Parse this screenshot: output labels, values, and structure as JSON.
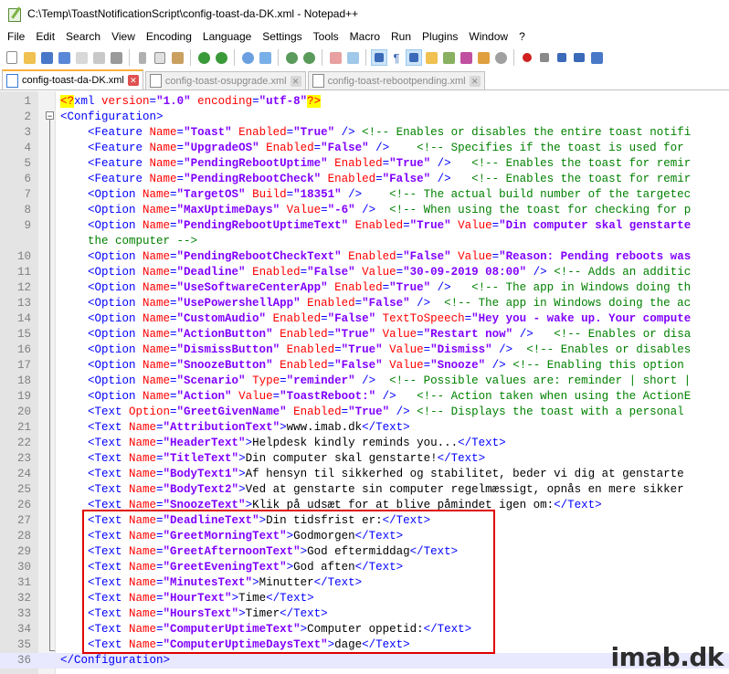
{
  "window": {
    "title": "C:\\Temp\\ToastNotificationScript\\config-toast-da-DK.xml - Notepad++"
  },
  "menu": [
    "File",
    "Edit",
    "Search",
    "View",
    "Encoding",
    "Language",
    "Settings",
    "Tools",
    "Macro",
    "Run",
    "Plugins",
    "Window",
    "?"
  ],
  "tabs": [
    {
      "label": "config-toast-da-DK.xml",
      "active": true
    },
    {
      "label": "config-toast-osupgrade.xml",
      "active": false
    },
    {
      "label": "config-toast-rebootpending.xml",
      "active": false
    }
  ],
  "watermark": "imab.dk",
  "lines": [
    [
      [
        "xmlpi",
        "<?"
      ],
      [
        "b",
        "xml "
      ],
      [
        "r",
        "version"
      ],
      [
        "b",
        "="
      ],
      [
        "p",
        "\"1.0\" "
      ],
      [
        "r",
        "encoding"
      ],
      [
        "b",
        "="
      ],
      [
        "p",
        "\"utf-8\""
      ],
      [
        "xmlpi",
        "?>"
      ]
    ],
    [
      [
        "b",
        "<Configuration>"
      ]
    ],
    [
      [
        "b",
        "    <Feature "
      ],
      [
        "r",
        "Name"
      ],
      [
        "b",
        "="
      ],
      [
        "p",
        "\"Toast\" "
      ],
      [
        "r",
        "Enabled"
      ],
      [
        "b",
        "="
      ],
      [
        "p",
        "\"True\" "
      ],
      [
        "b",
        "/> "
      ],
      [
        "c",
        "<!-- Enables or disables the entire toast notifi"
      ]
    ],
    [
      [
        "b",
        "    <Feature "
      ],
      [
        "r",
        "Name"
      ],
      [
        "b",
        "="
      ],
      [
        "p",
        "\"UpgradeOS\" "
      ],
      [
        "r",
        "Enabled"
      ],
      [
        "b",
        "="
      ],
      [
        "p",
        "\"False\" "
      ],
      [
        "b",
        "/>    "
      ],
      [
        "c",
        "<!-- Specifies if the toast is used for"
      ]
    ],
    [
      [
        "b",
        "    <Feature "
      ],
      [
        "r",
        "Name"
      ],
      [
        "b",
        "="
      ],
      [
        "p",
        "\"PendingRebootUptime\" "
      ],
      [
        "r",
        "Enabled"
      ],
      [
        "b",
        "="
      ],
      [
        "p",
        "\"True\" "
      ],
      [
        "b",
        "/>   "
      ],
      [
        "c",
        "<!-- Enables the toast for remir"
      ]
    ],
    [
      [
        "b",
        "    <Feature "
      ],
      [
        "r",
        "Name"
      ],
      [
        "b",
        "="
      ],
      [
        "p",
        "\"PendingRebootCheck\" "
      ],
      [
        "r",
        "Enabled"
      ],
      [
        "b",
        "="
      ],
      [
        "p",
        "\"False\" "
      ],
      [
        "b",
        "/>   "
      ],
      [
        "c",
        "<!-- Enables the toast for remir"
      ]
    ],
    [
      [
        "b",
        "    <Option "
      ],
      [
        "r",
        "Name"
      ],
      [
        "b",
        "="
      ],
      [
        "p",
        "\"TargetOS\" "
      ],
      [
        "r",
        "Build"
      ],
      [
        "b",
        "="
      ],
      [
        "p",
        "\"18351\" "
      ],
      [
        "b",
        "/>    "
      ],
      [
        "c",
        "<!-- The actual build number of the targetec"
      ]
    ],
    [
      [
        "b",
        "    <Option "
      ],
      [
        "r",
        "Name"
      ],
      [
        "b",
        "="
      ],
      [
        "p",
        "\"MaxUptimeDays\" "
      ],
      [
        "r",
        "Value"
      ],
      [
        "b",
        "="
      ],
      [
        "p",
        "\"-6\" "
      ],
      [
        "b",
        "/>  "
      ],
      [
        "c",
        "<!-- When using the toast for checking for p"
      ]
    ],
    [
      [
        "b",
        "    <Option "
      ],
      [
        "r",
        "Name"
      ],
      [
        "b",
        "="
      ],
      [
        "p",
        "\"PendingRebootUptimeText\" "
      ],
      [
        "r",
        "Enabled"
      ],
      [
        "b",
        "="
      ],
      [
        "p",
        "\"True\" "
      ],
      [
        "r",
        "Value"
      ],
      [
        "b",
        "="
      ],
      [
        "p",
        "\"Din computer skal genstarte"
      ]
    ],
    [
      [
        "c",
        "    the computer -->"
      ]
    ],
    [
      [
        "b",
        "    <Option "
      ],
      [
        "r",
        "Name"
      ],
      [
        "b",
        "="
      ],
      [
        "p",
        "\"PendingRebootCheckText\" "
      ],
      [
        "r",
        "Enabled"
      ],
      [
        "b",
        "="
      ],
      [
        "p",
        "\"False\" "
      ],
      [
        "r",
        "Value"
      ],
      [
        "b",
        "="
      ],
      [
        "p",
        "\"Reason: Pending reboots was"
      ]
    ],
    [
      [
        "b",
        "    <Option "
      ],
      [
        "r",
        "Name"
      ],
      [
        "b",
        "="
      ],
      [
        "p",
        "\"Deadline\" "
      ],
      [
        "r",
        "Enabled"
      ],
      [
        "b",
        "="
      ],
      [
        "p",
        "\"False\" "
      ],
      [
        "r",
        "Value"
      ],
      [
        "b",
        "="
      ],
      [
        "p",
        "\"30-09-2019 08:00\" "
      ],
      [
        "b",
        "/> "
      ],
      [
        "c",
        "<!-- Adds an additic"
      ]
    ],
    [
      [
        "b",
        "    <Option "
      ],
      [
        "r",
        "Name"
      ],
      [
        "b",
        "="
      ],
      [
        "p",
        "\"UseSoftwareCenterApp\" "
      ],
      [
        "r",
        "Enabled"
      ],
      [
        "b",
        "="
      ],
      [
        "p",
        "\"True\" "
      ],
      [
        "b",
        "/>   "
      ],
      [
        "c",
        "<!-- The app in Windows doing th"
      ]
    ],
    [
      [
        "b",
        "    <Option "
      ],
      [
        "r",
        "Name"
      ],
      [
        "b",
        "="
      ],
      [
        "p",
        "\"UsePowershellApp\" "
      ],
      [
        "r",
        "Enabled"
      ],
      [
        "b",
        "="
      ],
      [
        "p",
        "\"False\" "
      ],
      [
        "b",
        "/>  "
      ],
      [
        "c",
        "<!-- The app in Windows doing the ac"
      ]
    ],
    [
      [
        "b",
        "    <Option "
      ],
      [
        "r",
        "Name"
      ],
      [
        "b",
        "="
      ],
      [
        "p",
        "\"CustomAudio\" "
      ],
      [
        "r",
        "Enabled"
      ],
      [
        "b",
        "="
      ],
      [
        "p",
        "\"False\" "
      ],
      [
        "r",
        "TextToSpeech"
      ],
      [
        "b",
        "="
      ],
      [
        "p",
        "\"Hey you - wake up. Your compute"
      ]
    ],
    [
      [
        "b",
        "    <Option "
      ],
      [
        "r",
        "Name"
      ],
      [
        "b",
        "="
      ],
      [
        "p",
        "\"ActionButton\" "
      ],
      [
        "r",
        "Enabled"
      ],
      [
        "b",
        "="
      ],
      [
        "p",
        "\"True\" "
      ],
      [
        "r",
        "Value"
      ],
      [
        "b",
        "="
      ],
      [
        "p",
        "\"Restart now\" "
      ],
      [
        "b",
        "/>   "
      ],
      [
        "c",
        "<!-- Enables or disa"
      ]
    ],
    [
      [
        "b",
        "    <Option "
      ],
      [
        "r",
        "Name"
      ],
      [
        "b",
        "="
      ],
      [
        "p",
        "\"DismissButton\" "
      ],
      [
        "r",
        "Enabled"
      ],
      [
        "b",
        "="
      ],
      [
        "p",
        "\"True\" "
      ],
      [
        "r",
        "Value"
      ],
      [
        "b",
        "="
      ],
      [
        "p",
        "\"Dismiss\" "
      ],
      [
        "b",
        "/>  "
      ],
      [
        "c",
        "<!-- Enables or disables"
      ]
    ],
    [
      [
        "b",
        "    <Option "
      ],
      [
        "r",
        "Name"
      ],
      [
        "b",
        "="
      ],
      [
        "p",
        "\"SnoozeButton\" "
      ],
      [
        "r",
        "Enabled"
      ],
      [
        "b",
        "="
      ],
      [
        "p",
        "\"False\" "
      ],
      [
        "r",
        "Value"
      ],
      [
        "b",
        "="
      ],
      [
        "p",
        "\"Snooze\" "
      ],
      [
        "b",
        "/> "
      ],
      [
        "c",
        "<!-- Enabling this option"
      ]
    ],
    [
      [
        "b",
        "    <Option "
      ],
      [
        "r",
        "Name"
      ],
      [
        "b",
        "="
      ],
      [
        "p",
        "\"Scenario\" "
      ],
      [
        "r",
        "Type"
      ],
      [
        "b",
        "="
      ],
      [
        "p",
        "\"reminder\" "
      ],
      [
        "b",
        "/>  "
      ],
      [
        "c",
        "<!-- Possible values are: reminder | short |"
      ]
    ],
    [
      [
        "b",
        "    <Option "
      ],
      [
        "r",
        "Name"
      ],
      [
        "b",
        "="
      ],
      [
        "p",
        "\"Action\" "
      ],
      [
        "r",
        "Value"
      ],
      [
        "b",
        "="
      ],
      [
        "p",
        "\"ToastReboot:\" "
      ],
      [
        "b",
        "/>   "
      ],
      [
        "c",
        "<!-- Action taken when using the ActionE"
      ]
    ],
    [
      [
        "b",
        "    <Text "
      ],
      [
        "r",
        "Option"
      ],
      [
        "b",
        "="
      ],
      [
        "p",
        "\"GreetGivenName\" "
      ],
      [
        "r",
        "Enabled"
      ],
      [
        "b",
        "="
      ],
      [
        "p",
        "\"True\" "
      ],
      [
        "b",
        "/> "
      ],
      [
        "c",
        "<!-- Displays the toast with a personal"
      ]
    ],
    [
      [
        "b",
        "    <Text "
      ],
      [
        "r",
        "Name"
      ],
      [
        "b",
        "="
      ],
      [
        "p",
        "\"AttributionText\""
      ],
      [
        "b",
        ">"
      ],
      [
        "t",
        "www.imab.dk"
      ],
      [
        "b",
        "</Text>"
      ]
    ],
    [
      [
        "b",
        "    <Text "
      ],
      [
        "r",
        "Name"
      ],
      [
        "b",
        "="
      ],
      [
        "p",
        "\"HeaderText\""
      ],
      [
        "b",
        ">"
      ],
      [
        "t",
        "Helpdesk kindly reminds you..."
      ],
      [
        "b",
        "</Text>"
      ]
    ],
    [
      [
        "b",
        "    <Text "
      ],
      [
        "r",
        "Name"
      ],
      [
        "b",
        "="
      ],
      [
        "p",
        "\"TitleText\""
      ],
      [
        "b",
        ">"
      ],
      [
        "t",
        "Din computer skal genstarte!"
      ],
      [
        "b",
        "</Text>"
      ]
    ],
    [
      [
        "b",
        "    <Text "
      ],
      [
        "r",
        "Name"
      ],
      [
        "b",
        "="
      ],
      [
        "p",
        "\"BodyText1\""
      ],
      [
        "b",
        ">"
      ],
      [
        "t",
        "Af hensyn til sikkerhed og stabilitet, beder vi dig at genstarte"
      ]
    ],
    [
      [
        "b",
        "    <Text "
      ],
      [
        "r",
        "Name"
      ],
      [
        "b",
        "="
      ],
      [
        "p",
        "\"BodyText2\""
      ],
      [
        "b",
        ">"
      ],
      [
        "t",
        "Ved at genstarte sin computer regelmæssigt, opnås en mere sikker"
      ]
    ],
    [
      [
        "b",
        "    <Text "
      ],
      [
        "r",
        "Name"
      ],
      [
        "b",
        "="
      ],
      [
        "p",
        "\"SnoozeText\""
      ],
      [
        "b",
        ">"
      ],
      [
        "t",
        "Klik på udsæt for at blive påmindet igen om:"
      ],
      [
        "b",
        "</Text>"
      ]
    ],
    [
      [
        "b",
        "    <Text "
      ],
      [
        "r",
        "Name"
      ],
      [
        "b",
        "="
      ],
      [
        "p",
        "\"DeadlineText\""
      ],
      [
        "b",
        ">"
      ],
      [
        "t",
        "Din tidsfrist er:"
      ],
      [
        "b",
        "</Text>"
      ]
    ],
    [
      [
        "b",
        "    <Text "
      ],
      [
        "r",
        "Name"
      ],
      [
        "b",
        "="
      ],
      [
        "p",
        "\"GreetMorningText\""
      ],
      [
        "b",
        ">"
      ],
      [
        "t",
        "Godmorgen"
      ],
      [
        "b",
        "</Text>"
      ]
    ],
    [
      [
        "b",
        "    <Text "
      ],
      [
        "r",
        "Name"
      ],
      [
        "b",
        "="
      ],
      [
        "p",
        "\"GreetAfternoonText\""
      ],
      [
        "b",
        ">"
      ],
      [
        "t",
        "God eftermiddag"
      ],
      [
        "b",
        "</Text>"
      ]
    ],
    [
      [
        "b",
        "    <Text "
      ],
      [
        "r",
        "Name"
      ],
      [
        "b",
        "="
      ],
      [
        "p",
        "\"GreetEveningText\""
      ],
      [
        "b",
        ">"
      ],
      [
        "t",
        "God aften"
      ],
      [
        "b",
        "</Text>"
      ]
    ],
    [
      [
        "b",
        "    <Text "
      ],
      [
        "r",
        "Name"
      ],
      [
        "b",
        "="
      ],
      [
        "p",
        "\"MinutesText\""
      ],
      [
        "b",
        ">"
      ],
      [
        "t",
        "Minutter"
      ],
      [
        "b",
        "</Text>"
      ]
    ],
    [
      [
        "b",
        "    <Text "
      ],
      [
        "r",
        "Name"
      ],
      [
        "b",
        "="
      ],
      [
        "p",
        "\"HourText\""
      ],
      [
        "b",
        ">"
      ],
      [
        "t",
        "Time"
      ],
      [
        "b",
        "</Text>"
      ]
    ],
    [
      [
        "b",
        "    <Text "
      ],
      [
        "r",
        "Name"
      ],
      [
        "b",
        "="
      ],
      [
        "p",
        "\"HoursText\""
      ],
      [
        "b",
        ">"
      ],
      [
        "t",
        "Timer"
      ],
      [
        "b",
        "</Text>"
      ]
    ],
    [
      [
        "b",
        "    <Text "
      ],
      [
        "r",
        "Name"
      ],
      [
        "b",
        "="
      ],
      [
        "p",
        "\"ComputerUptimeText\""
      ],
      [
        "b",
        ">"
      ],
      [
        "t",
        "Computer oppetid:"
      ],
      [
        "b",
        "</Text>"
      ]
    ],
    [
      [
        "b",
        "    <Text "
      ],
      [
        "r",
        "Name"
      ],
      [
        "b",
        "="
      ],
      [
        "p",
        "\"ComputerUptimeDaysText\""
      ],
      [
        "b",
        ">"
      ],
      [
        "t",
        "dage"
      ],
      [
        "b",
        "</Text>"
      ]
    ],
    [
      [
        "b",
        "</Configuration>"
      ]
    ]
  ],
  "line_numbers": [
    "1",
    "2",
    "3",
    "4",
    "5",
    "6",
    "7",
    "8",
    "9",
    "",
    "10",
    "11",
    "12",
    "13",
    "14",
    "15",
    "16",
    "17",
    "18",
    "19",
    "20",
    "21",
    "22",
    "23",
    "24",
    "25",
    "26",
    "27",
    "28",
    "29",
    "30",
    "31",
    "32",
    "33",
    "34",
    "35",
    "36"
  ]
}
